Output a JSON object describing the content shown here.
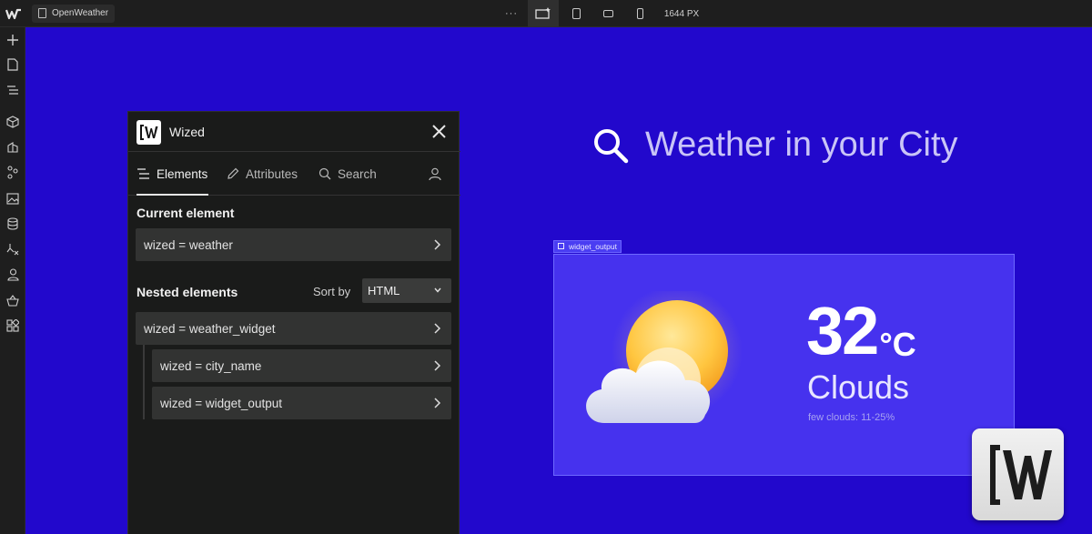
{
  "topbar": {
    "page_name": "OpenWeather",
    "more_label": "···",
    "width_readout": "1644 PX"
  },
  "sidebar": {
    "icons": [
      "add-icon",
      "pages-icon",
      "navigator-icon",
      "components-icon",
      "style-selector-icon",
      "assets-icon",
      "image-icon",
      "cms-icon",
      "logic-icon",
      "users-icon",
      "ecommerce-icon",
      "apps-icon"
    ]
  },
  "canvas": {
    "background": "#2208cc",
    "heading": "Weather in your City",
    "selection_label": "widget_output",
    "weather": {
      "temperature": "32",
      "unit": "°C",
      "condition": "Clouds",
      "description": "few clouds: 11-25%"
    }
  },
  "panel": {
    "title": "Wized",
    "tabs": [
      {
        "label": "Elements",
        "icon": "list-icon",
        "active": true
      },
      {
        "label": "Attributes",
        "icon": "pencil-icon",
        "active": false
      },
      {
        "label": "Search",
        "icon": "search-icon",
        "active": false
      }
    ],
    "current_section": "Current element",
    "current_element": "wized = weather",
    "nested_section": "Nested elements",
    "sort_label": "Sort by",
    "sort_value": "HTML",
    "nested": [
      {
        "label": "wized = weather_widget",
        "level": 0
      },
      {
        "label": "wized = city_name",
        "level": 1
      },
      {
        "label": "wized = widget_output",
        "level": 1
      }
    ]
  }
}
